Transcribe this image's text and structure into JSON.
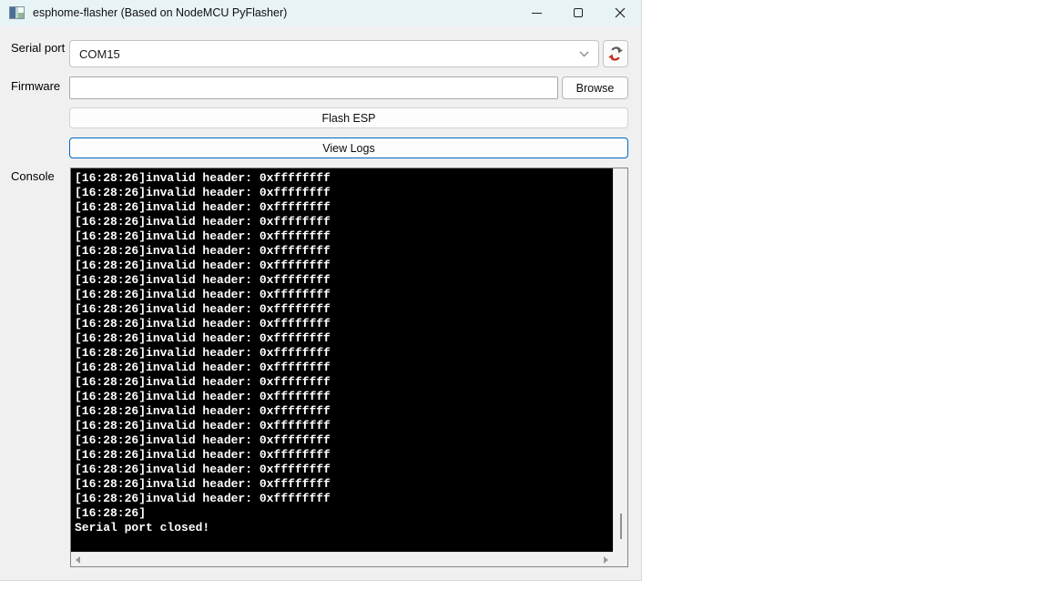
{
  "window": {
    "title": "esphome-flasher (Based on NodeMCU PyFlasher)"
  },
  "form": {
    "serial_port": {
      "label": "Serial port",
      "value": "COM15"
    },
    "firmware": {
      "label": "Firmware",
      "value": "",
      "placeholder": ""
    },
    "browse_label": "Browse",
    "flash_label": "Flash ESP",
    "view_logs_label": "View Logs"
  },
  "console": {
    "label": "Console",
    "lines": [
      "[16:28:26]invalid header: 0xffffffff",
      "[16:28:26]invalid header: 0xffffffff",
      "[16:28:26]invalid header: 0xffffffff",
      "[16:28:26]invalid header: 0xffffffff",
      "[16:28:26]invalid header: 0xffffffff",
      "[16:28:26]invalid header: 0xffffffff",
      "[16:28:26]invalid header: 0xffffffff",
      "[16:28:26]invalid header: 0xffffffff",
      "[16:28:26]invalid header: 0xffffffff",
      "[16:28:26]invalid header: 0xffffffff",
      "[16:28:26]invalid header: 0xffffffff",
      "[16:28:26]invalid header: 0xffffffff",
      "[16:28:26]invalid header: 0xffffffff",
      "[16:28:26]invalid header: 0xffffffff",
      "[16:28:26]invalid header: 0xffffffff",
      "[16:28:26]invalid header: 0xffffffff",
      "[16:28:26]invalid header: 0xffffffff",
      "[16:28:26]invalid header: 0xffffffff",
      "[16:28:26]invalid header: 0xffffffff",
      "[16:28:26]invalid header: 0xffffffff",
      "[16:28:26]invalid header: 0xffffffff",
      "[16:28:26]invalid header: 0xffffffff",
      "[16:28:26]invalid header: 0xffffffff",
      "[16:28:26]",
      "Serial port closed!"
    ]
  },
  "colors": {
    "accent": "#0067c0",
    "titlebar_bg": "#e8f3f6",
    "window_bg": "#f0f0f0",
    "console_bg": "#000000",
    "console_fg": "#ffffff",
    "refresh_red": "#c42b1c",
    "refresh_gray": "#595959"
  },
  "icons": {
    "app": "app-icon",
    "refresh": "refresh-icon",
    "chevron": "chevron-down-icon",
    "minimize": "minimize-icon",
    "maximize": "maximize-icon",
    "close": "close-icon"
  }
}
